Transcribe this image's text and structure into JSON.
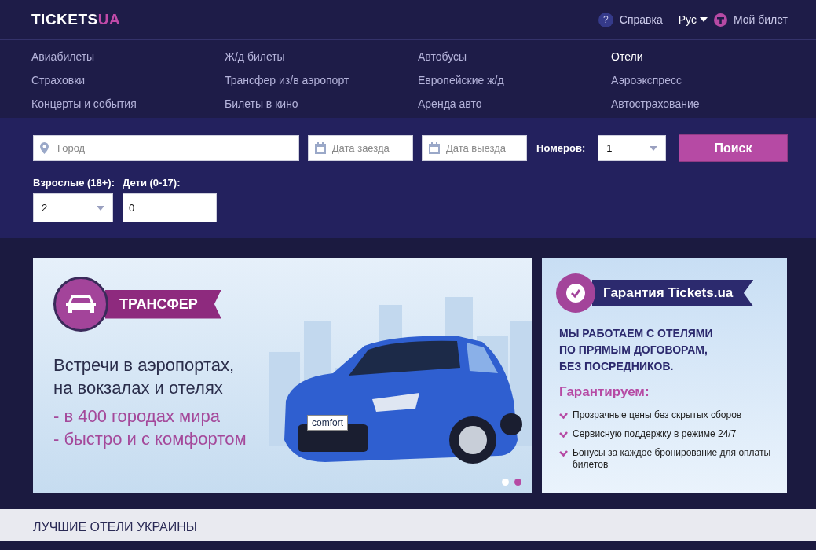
{
  "header": {
    "logo": {
      "main": "TICKETS",
      "accent": "UA"
    },
    "help_icon": "?",
    "help": "Справка",
    "language": "Рус",
    "my_ticket": "Мой билет"
  },
  "nav": [
    {
      "label": "Авиабилеты",
      "selected": false
    },
    {
      "label": "Ж/д билеты",
      "selected": false
    },
    {
      "label": "Автобусы",
      "selected": false
    },
    {
      "label": "Отели",
      "selected": true
    },
    {
      "label": "Страховки",
      "selected": false
    },
    {
      "label": "Трансфер из/в аэропорт",
      "selected": false
    },
    {
      "label": "Европейские ж/д",
      "selected": false
    },
    {
      "label": "Аэроэкспресс",
      "selected": false
    },
    {
      "label": "Концерты и события",
      "selected": false
    },
    {
      "label": "Билеты в кино",
      "selected": false
    },
    {
      "label": "Аренда авто",
      "selected": false
    },
    {
      "label": "Автострахование",
      "selected": false
    }
  ],
  "search": {
    "city": {
      "placeholder": "Город"
    },
    "checkin": {
      "placeholder": "Дата заезда"
    },
    "checkout": {
      "placeholder": "Дата выезда"
    },
    "rooms_label": "Номеров:",
    "rooms": "1",
    "button": "Поиск",
    "adults_label": "Взрослые (18+):",
    "adults": "2",
    "children_label": "Дети (0-17):",
    "children": "0"
  },
  "transfer_banner": {
    "tag": "ТРАНСФЕР",
    "headline": [
      "Встречи в аэропортах,",
      "на вокзалах и отелях"
    ],
    "points": [
      "- в 400 городах мира",
      "- быстро и с комфортом"
    ],
    "plate": "comfort",
    "dots": [
      {
        "selected": false
      },
      {
        "selected": true
      }
    ]
  },
  "guarantee_banner": {
    "title": "Гарантия Tickets.ua",
    "statement": [
      "МЫ РАБОТАЕМ С ОТЕЛЯМИ",
      "ПО ПРЯМЫМ ДОГОВОРАМ,",
      "БЕЗ ПОСРЕДНИКОВ."
    ],
    "subtitle": "Гарантируем:",
    "items": [
      "Прозрачные цены без скрытых сборов",
      "Сервисную поддержку в режиме 24/7",
      "Бонусы за каждое бронирование для оплаты билетов"
    ]
  },
  "section_title": "ЛУЧШИЕ ОТЕЛИ УКРАИНЫ"
}
